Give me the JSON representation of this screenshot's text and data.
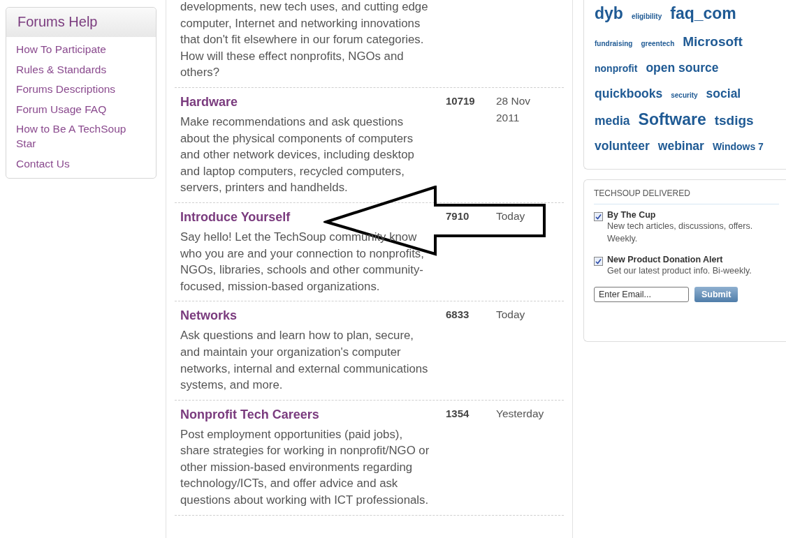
{
  "help_box": {
    "title": "Forums Help",
    "links": [
      "How To Participate",
      "Rules & Standards",
      "Forums Descriptions",
      "Forum Usage FAQ",
      "How to Be A TechSoup Star",
      "Contact Us"
    ]
  },
  "forums": [
    {
      "description": "developments, new tech uses, and cutting edge computer, Internet and networking innovations that don't fit elsewhere in our forum categories. How will these effect nonprofits, NGOs and others?"
    },
    {
      "title": "Hardware",
      "description": "Make recommendations and ask questions about the physical components of computers and other network devices, including desktop and laptop computers, recycled computers, servers, printers and handhelds.",
      "count": "10719",
      "date": "28 Nov 2011"
    },
    {
      "title": "Introduce Yourself",
      "description": "Say hello! Let the TechSoup community know who you are and your connection to nonprofits, NGOs, libraries, schools and other community-focused, mission-based organizations.",
      "count": "7910",
      "date": "Today"
    },
    {
      "title": "Networks",
      "description": "Ask questions and learn how to plan, secure, and maintain your organization's computer networks, internal and external communications systems, and more.",
      "count": "6833",
      "date": "Today"
    },
    {
      "title": "Nonprofit Tech Careers",
      "description": "Post employment opportunities (paid jobs), share strategies for working in nonprofit/NGO or other mission-based environments regarding technology/ICTs, and offer advice and ask questions about working with ICT professionals.",
      "count": "1354",
      "date": "Yesterday"
    }
  ],
  "tags": [
    {
      "label": "dyb",
      "kind": "xl"
    },
    {
      "label": "eligibility",
      "kind": "xs"
    },
    {
      "label": "faq_com",
      "kind": "xl"
    },
    {
      "label": "fundraising",
      "kind": "xs"
    },
    {
      "label": "greentech",
      "kind": "xs"
    },
    {
      "label": "Microsoft",
      "kind": "l"
    },
    {
      "label": "nonprofit",
      "kind": "s"
    },
    {
      "label": "open source",
      "kind": "m"
    },
    {
      "label": "quickbooks",
      "kind": "m"
    },
    {
      "label": "security",
      "kind": "xs"
    },
    {
      "label": "social",
      "kind": "m"
    },
    {
      "label": "media",
      "kind": "m"
    },
    {
      "label": "Software",
      "kind": "xl"
    },
    {
      "label": "tsdigs",
      "kind": "l"
    },
    {
      "label": "volunteer",
      "kind": "m"
    },
    {
      "label": "webinar",
      "kind": "m"
    },
    {
      "label": "Windows 7",
      "kind": "s"
    }
  ],
  "delivered": {
    "title": "TECHSOUP DELIVERED",
    "options": [
      {
        "label": "By The Cup",
        "description": "New tech articles, discussions, offers. Weekly.",
        "checked": true
      },
      {
        "label": "New Product Donation Alert",
        "description": "Get our latest product info. Bi-weekly.",
        "checked": true
      }
    ],
    "email": {
      "placeholder": "Enter Email..."
    },
    "submit": "Submit"
  }
}
